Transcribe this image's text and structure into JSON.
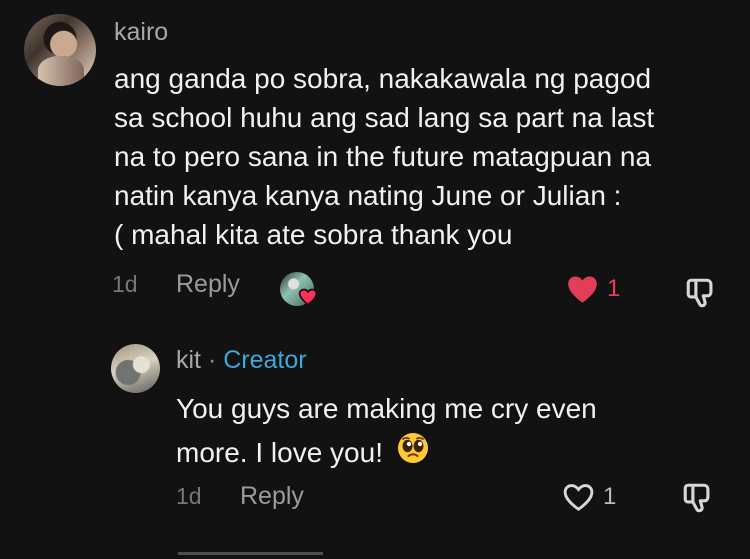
{
  "comments": {
    "main": {
      "username": "kairo",
      "text_lines": [
        "ang ganda po sobra, nakakawala ng pagod",
        "sa school huhu ang sad lang sa part na last",
        "na to pero sana in the future matagpuan na",
        "natin kanya kanya nating June or Julian :",
        "( mahal kita ate sobra thank you"
      ],
      "time": "1d",
      "reply_label": "Reply",
      "likes": "1",
      "liked": true
    },
    "reply": {
      "username": "kit",
      "separator": "·",
      "creator_label": "Creator",
      "text_lines": [
        "You guys are making me cry even",
        "more. I love you!"
      ],
      "emoji": "pleading-face",
      "time": "1d",
      "reply_label": "Reply",
      "likes": "1",
      "liked": false
    }
  },
  "colors": {
    "background": "#121212",
    "creator": "#3ba8d8",
    "liked": "#e33e58",
    "muted": "#9b9b9b"
  },
  "icons": {
    "like": "heart-icon",
    "dislike": "thumbs-down-icon",
    "emoji": "pleading-face-emoji"
  }
}
